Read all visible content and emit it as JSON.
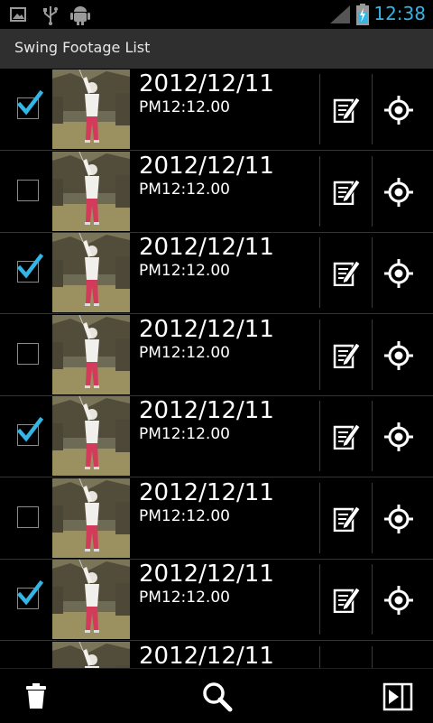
{
  "statusbar": {
    "time": "12:38",
    "icons": [
      "image-notification-icon",
      "usb-icon",
      "android-debug-icon",
      "signal-icon",
      "battery-charging-icon"
    ],
    "accent": "#33b5e5"
  },
  "header": {
    "title": "Swing Footage List"
  },
  "list": {
    "items": [
      {
        "date": "2012/12/11",
        "time": "PM12:12.00",
        "checked": true
      },
      {
        "date": "2012/12/11",
        "time": "PM12:12.00",
        "checked": false
      },
      {
        "date": "2012/12/11",
        "time": "PM12:12.00",
        "checked": true
      },
      {
        "date": "2012/12/11",
        "time": "PM12:12.00",
        "checked": false
      },
      {
        "date": "2012/12/11",
        "time": "PM12:12.00",
        "checked": true
      },
      {
        "date": "2012/12/11",
        "time": "PM12:12.00",
        "checked": false
      },
      {
        "date": "2012/12/11",
        "time": "PM12:12.00",
        "checked": true
      },
      {
        "date": "2012/12/11",
        "time": "",
        "checked": false
      }
    ]
  },
  "bottombar": {
    "icons": [
      "trash-icon",
      "search-icon",
      "play-export-icon"
    ]
  }
}
